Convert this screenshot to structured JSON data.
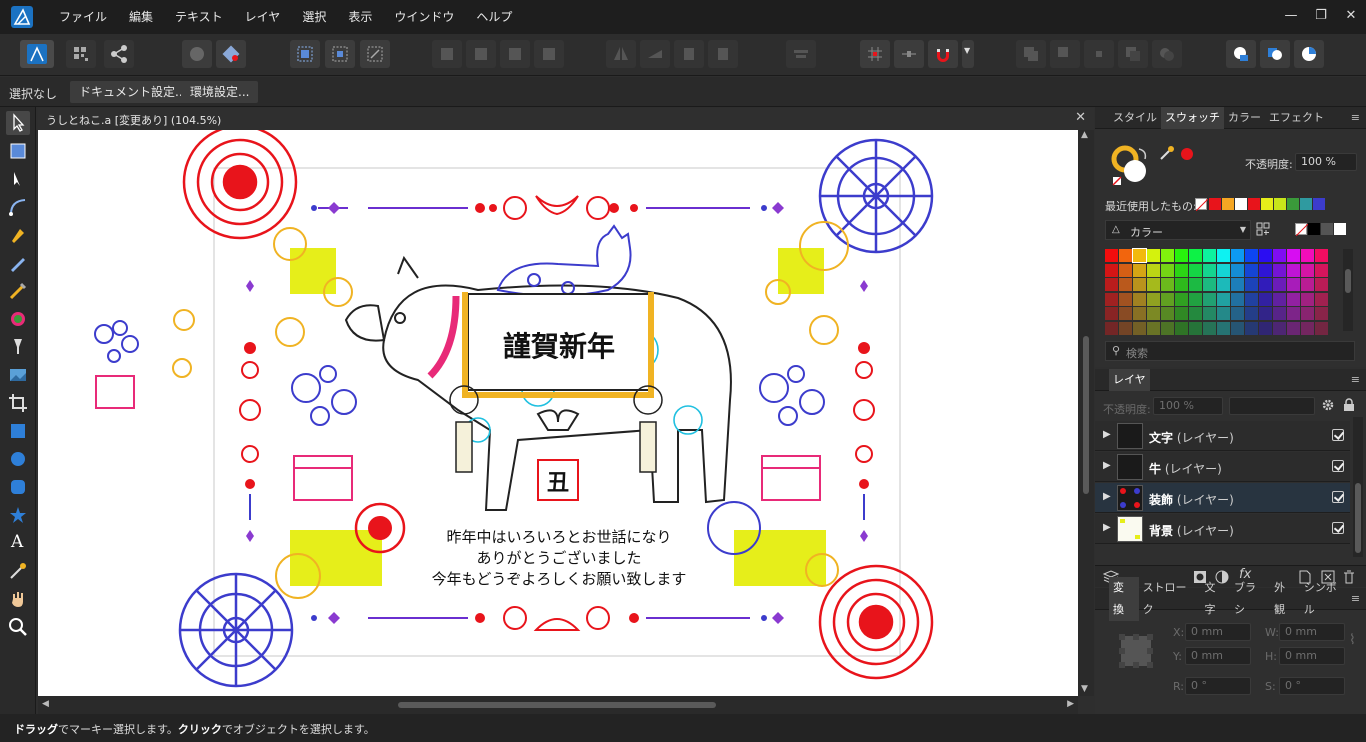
{
  "menu": {
    "items": [
      "ファイル",
      "編集",
      "テキスト",
      "レイヤ",
      "選択",
      "表示",
      "ウインドウ",
      "ヘルプ"
    ],
    "window_controls": [
      "—",
      "❐",
      "✕"
    ]
  },
  "context": {
    "selection_label": "選択なし",
    "document_settings": "ドキュメント設定...",
    "preferences": "環境設定..."
  },
  "document": {
    "title": "うしとねこ.a [変更あり] (104.5%)",
    "close": "✕"
  },
  "artwork": {
    "banner_text": "謹賀新年",
    "zodiac_char": "丑",
    "greeting_lines": [
      "昨年中はいろいろとお世話になり",
      "ありがとうございました",
      "今年もどうぞよろしくお願い致します"
    ],
    "colors": {
      "red": "#e8141b",
      "blue": "#3c3ccc",
      "yellow": "#e6ee1a",
      "gold": "#f0b323",
      "purple": "#6a2fd0",
      "pink": "#e82a78"
    }
  },
  "swatch_panel": {
    "tabs": [
      "スタイル",
      "スウォッチ",
      "カラー",
      "エフェクト"
    ],
    "active_tab": "スウォッチ",
    "opacity_label": "不透明度:",
    "opacity_value": "100 %",
    "recent_label": "最近使用したもの:",
    "recent_colors": [
      "#e8141b",
      "#f5a623",
      "#ffffff",
      "#e8141b",
      "#e6ee1a",
      "#c8e61a",
      "#3a9a3a",
      "#2f9aa0",
      "#3c3ccc"
    ],
    "palette_name": "カラー",
    "search_placeholder": "検索"
  },
  "layers_panel": {
    "tab": "レイヤ",
    "opacity_label": "不透明度:",
    "opacity_value": "100 %",
    "layers": [
      {
        "name": "文字",
        "type": "(レイヤー)",
        "selected": false
      },
      {
        "name": "牛",
        "type": "(レイヤー)",
        "selected": false
      },
      {
        "name": "装飾",
        "type": "(レイヤー)",
        "selected": true
      },
      {
        "name": "背景",
        "type": "(レイヤー)",
        "selected": false
      }
    ]
  },
  "transform_panel": {
    "tabs": [
      "変換",
      "ストローク",
      "文字",
      "ブラシ",
      "外観",
      "シンボル"
    ],
    "active_tab": "変換",
    "x_label": "X:",
    "x_value": "0 mm",
    "y_label": "Y:",
    "y_value": "0 mm",
    "w_label": "W:",
    "w_value": "0 mm",
    "h_label": "H:",
    "h_value": "0 mm",
    "r_label": "R:",
    "r_value": "0 °",
    "s_label": "S:",
    "s_value": "0 °"
  },
  "status": {
    "drag_bold": "ドラッグ",
    "drag_rest": "でマーキー選択します。",
    "click_bold": "クリック",
    "click_rest": "でオブジェクトを選択します。"
  }
}
